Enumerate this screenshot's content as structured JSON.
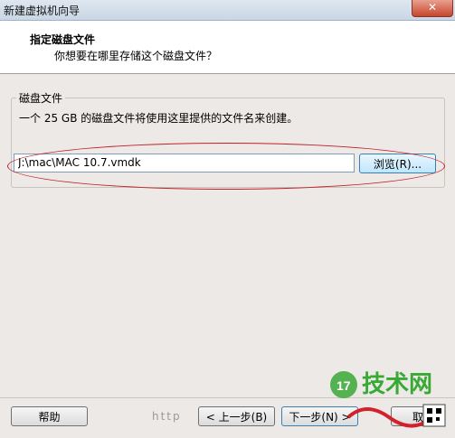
{
  "window": {
    "title": "新建虚拟机向导"
  },
  "header": {
    "title": "指定磁盘文件",
    "subtitle": "你想要在哪里存储这个磁盘文件？"
  },
  "group": {
    "label": "磁盘文件",
    "description": "一个 25 GB 的磁盘文件将使用这里提供的文件名来创建。",
    "path_value": "J:\\mac\\MAC 10.7.vmdk",
    "browse_label": "浏览(R)..."
  },
  "buttons": {
    "help": "帮助",
    "back": "< 上一步(B)",
    "next": "下一步(N) >",
    "last": "取"
  },
  "watermark": {
    "site_name": "技术网",
    "url_fragment": "http"
  },
  "colors": {
    "annotation_oval": "#c2212b",
    "watermark_green": "#39a935",
    "watermark_red": "#d3202a"
  }
}
